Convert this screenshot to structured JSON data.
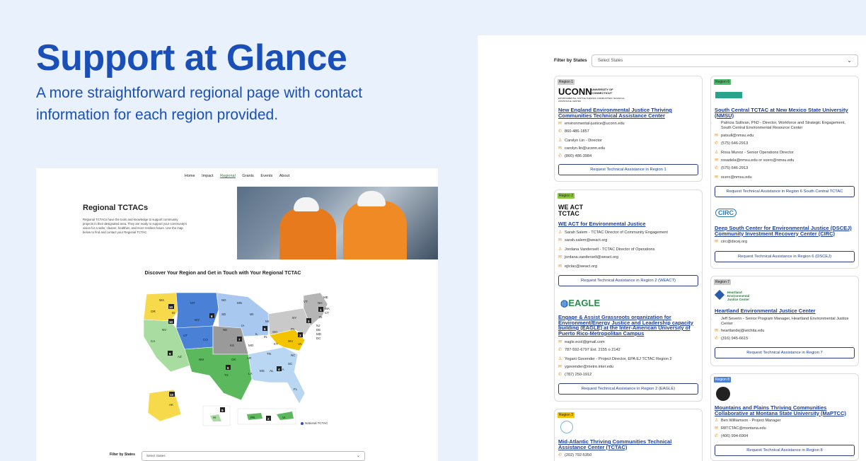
{
  "hero": {
    "title": "Support at Glance",
    "subtitle": "A more straightforward regional page with contact information for each region provided."
  },
  "mockup": {
    "nav": [
      "Home",
      "Impact",
      "Regional",
      "Grants",
      "Events",
      "About"
    ],
    "active_nav": "Regional",
    "title": "Regional TCTACs",
    "description": "Regional TCTACs have the tools and knowledge to support community projects in their designated area. They are ready to support your community's vision for a safer, cleaner, healthier, and more resilient future. Use the map below to find and contact your Regional TCTAC.",
    "map_title": "Discover Your Region and Get in Touch with Your Regional TCTAC",
    "legend": "National TCTAC",
    "filter_label": "Filter by States",
    "filter_placeholder": "Select States",
    "map_states": [
      "WA",
      "OR",
      "ID",
      "MT",
      "WY",
      "ND",
      "SD",
      "NE",
      "MN",
      "IA",
      "WI",
      "MI",
      "IL",
      "IN",
      "OH",
      "NY",
      "PA",
      "VT",
      "NH",
      "ME",
      "MA",
      "CT",
      "RI",
      "NJ",
      "DE",
      "MD",
      "DC",
      "WV",
      "VA",
      "KY",
      "TN",
      "NC",
      "SC",
      "GA",
      "AL",
      "MS",
      "LA",
      "AR",
      "MO",
      "KS",
      "OK",
      "TX",
      "NM",
      "CO",
      "UT",
      "AZ",
      "NV",
      "CA",
      "FL",
      "AK",
      "HI",
      "PR",
      "VI"
    ],
    "region_numbers": [
      "10",
      "10",
      "8",
      "5",
      "7",
      "9",
      "6",
      "4",
      "2",
      "3",
      "1",
      "9",
      "2",
      "10"
    ]
  },
  "panel": {
    "filter_label": "Filter by States",
    "filter_placeholder": "Select States",
    "cards": [
      {
        "region": "Region 1",
        "badge_color": "#c9c9c9",
        "logo": "UCONN",
        "logo_sub": "UNIVERSITY OF CONNECTICUT",
        "logo_sub2": "ENVIRONMENTAL JUSTICE THRIVING COMMUNITIES TECHNICAL ASSISTANCE CENTER",
        "org": "New England Environmental Justice Thriving Communities Technical Assistance Center",
        "rows": [
          {
            "icon": "mail-icon",
            "text": "environmental-justice@uconn.edu"
          },
          {
            "icon": "phone-icon",
            "text": "860-486-1857"
          },
          {
            "icon": "person-icon",
            "text": "Carolyn Lin - Director"
          },
          {
            "icon": "mail-icon",
            "text": "carolyn.lin@uconn.edu"
          },
          {
            "icon": "phone-icon",
            "text": "(860) 486-3984"
          }
        ],
        "button": "Request Technical Assistance in Region 1"
      },
      {
        "region": "Region 2",
        "badge_color": "#8dc63f",
        "logo": "WE ACT TCTAC",
        "org": "WE ACT for Environmental Justice",
        "rows": [
          {
            "icon": "person-icon",
            "text": "Sarah Salem - TCTAC Director of Community Engagement"
          },
          {
            "icon": "mail-icon",
            "text": "sarah.salem@weact.org"
          },
          {
            "icon": "person-icon",
            "text": "Jordana Vanderselt - TCTAC Director of Operations"
          },
          {
            "icon": "mail-icon",
            "text": "jordana.vanderselt@weact.org"
          },
          {
            "icon": "mail-icon",
            "text": "ejtctac@weact.org"
          }
        ],
        "button": "Request Technical Assistance in Region 2 (WEACT)",
        "logo2": "EAGLE",
        "org2": "Engage & Assist Grassroots organization for Environment/Energy Justice and Leadership capacity building (EAGLE) at the Inter-American University of Puerto Rico-Metropolitan Campus",
        "rows2": [
          {
            "icon": "mail-icon",
            "text": "eagle.ecol@gmail.com"
          },
          {
            "icon": "phone-icon",
            "text": "787-592-6797 Ext. 2155 o 2142"
          },
          {
            "icon": "person-icon",
            "text": "Yogani Govender - Project Director, EPA EJ TCTAC Region 2"
          },
          {
            "icon": "mail-icon",
            "text": "ygovender@metro.inter.edu"
          },
          {
            "icon": "phone-icon",
            "text": "(787) 250-1912"
          }
        ],
        "button2": "Request Technical Assistance in Region 2 (EAGLE)"
      },
      {
        "region": "Region 3",
        "badge_color": "#f5c400",
        "org": "Mid-Atlantic Thriving Communities Technical Assistance Center (TCTAC)",
        "rows": [
          {
            "icon": "phone-icon",
            "text": "(202) 792-5350"
          }
        ]
      },
      {
        "region": "Region 6",
        "badge_color": "#4cbb6c",
        "org": "South Central TCTAC at New Mexico State University (NMSU)",
        "rows": [
          {
            "icon": "person-icon",
            "text": "Patricia Sullivan, PhD - Director, Workforce and Strategic Engagement, South Central Environmental Resource Center"
          },
          {
            "icon": "mail-icon",
            "text": "patsull@nmsu.edu"
          },
          {
            "icon": "phone-icon",
            "text": "(575) 646-2913"
          },
          {
            "icon": "person-icon",
            "text": "Rosa Munoz - Senior Operations Director"
          },
          {
            "icon": "mail-icon",
            "text": "rosadela@nmsu.edu or scerc@nmsu.edu"
          },
          {
            "icon": "phone-icon",
            "text": "(575) 646-2913"
          },
          {
            "icon": "mail-icon",
            "text": "scerc@nmsu.edu"
          }
        ],
        "button": "Request Technical Assistance in Region 6 South Central TCTAC",
        "logo2": "CIRC",
        "org2": "Deep South Center for Environmental Justice (DSCEJ) Community Investment Recovery Center (CIRC)",
        "rows2": [
          {
            "icon": "mail-icon",
            "text": "circ@dscej.org"
          }
        ],
        "button2": "Request Technical Assistance in Region 6 (DSCEJ)"
      },
      {
        "region": "Region 7",
        "badge_color": "#c9c9c9",
        "logo": "Heartland Environmental Justice Center",
        "org": "Heartland Environmental Justice Center",
        "rows": [
          {
            "icon": "person-icon",
            "text": "Jeff Severin - Senior Program Manager, Heartland Environmental Justice Center"
          },
          {
            "icon": "mail-icon",
            "text": "heartlandej@wichita.edu"
          },
          {
            "icon": "phone-icon",
            "text": "(316) 945-6615"
          }
        ],
        "button": "Request Technical Assistance in Region 7"
      },
      {
        "region": "Region 8",
        "badge_color": "#4a80d6",
        "org": "Mountains and Plains Thriving Communities Collaborative at Montana State University (MaPTCC)",
        "rows": [
          {
            "icon": "person-icon",
            "text": "Ben Williamson - Project Manager"
          },
          {
            "icon": "mail-icon",
            "text": "R8TCTAC@montana.edu"
          },
          {
            "icon": "phone-icon",
            "text": "(406) 994-6904"
          }
        ],
        "button": "Request Technical Assistance in Region 8"
      }
    ]
  }
}
